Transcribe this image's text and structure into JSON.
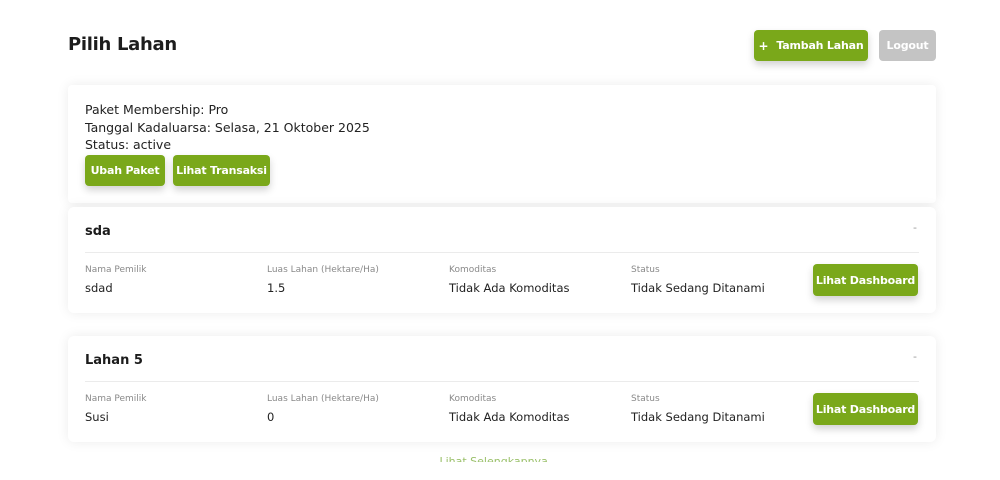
{
  "header": {
    "title": "Pilih Lahan",
    "add_label": "Tambah Lahan",
    "add_icon": "+",
    "logout_label": "Logout"
  },
  "membership": {
    "paket": "Paket Membership: Pro",
    "kadaluarsa": "Tanggal Kadaluarsa: Selasa, 21 Oktober 2025",
    "status": "Status: active",
    "ubah_label": "Ubah Paket",
    "transaksi_label": "Lihat Transaksi"
  },
  "labels": {
    "pemilik": "Nama Pemilik",
    "luas": "Luas Lahan (Hektare/Ha)",
    "komoditas": "Komoditas",
    "status": "Status",
    "dashboard": "Lihat Dashboard",
    "collapse": "-"
  },
  "lahan": [
    {
      "name": "sda",
      "pemilik": "sdad",
      "luas": "1.5",
      "komoditas": "Tidak Ada Komoditas",
      "status": "Tidak Sedang Ditanami"
    },
    {
      "name": "Lahan 5",
      "pemilik": "Susi",
      "luas": "0",
      "komoditas": "Tidak Ada Komoditas",
      "status": "Tidak Sedang Ditanami"
    }
  ],
  "footer": {
    "see_all": "Lihat Selengkapnya ⌄"
  },
  "colors": {
    "accent": "#7aa81a",
    "logout": "#c4c4c4"
  }
}
